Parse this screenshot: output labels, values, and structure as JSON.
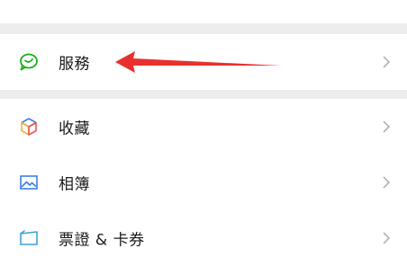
{
  "menu": {
    "items": [
      {
        "label": "服務",
        "icon": "services-icon"
      },
      {
        "label": "收藏",
        "icon": "favorites-icon"
      },
      {
        "label": "相簿",
        "icon": "album-icon"
      },
      {
        "label": "票證 & 卡券",
        "icon": "cards-offers-icon"
      }
    ]
  },
  "colors": {
    "services_icon": "#1AAD19",
    "arrow": "#E8312F",
    "separator": "#EDEDED",
    "chevron": "#B2B2B2",
    "album_icon": "#3D7EE6",
    "cards_icon": "#3AA3D9"
  }
}
